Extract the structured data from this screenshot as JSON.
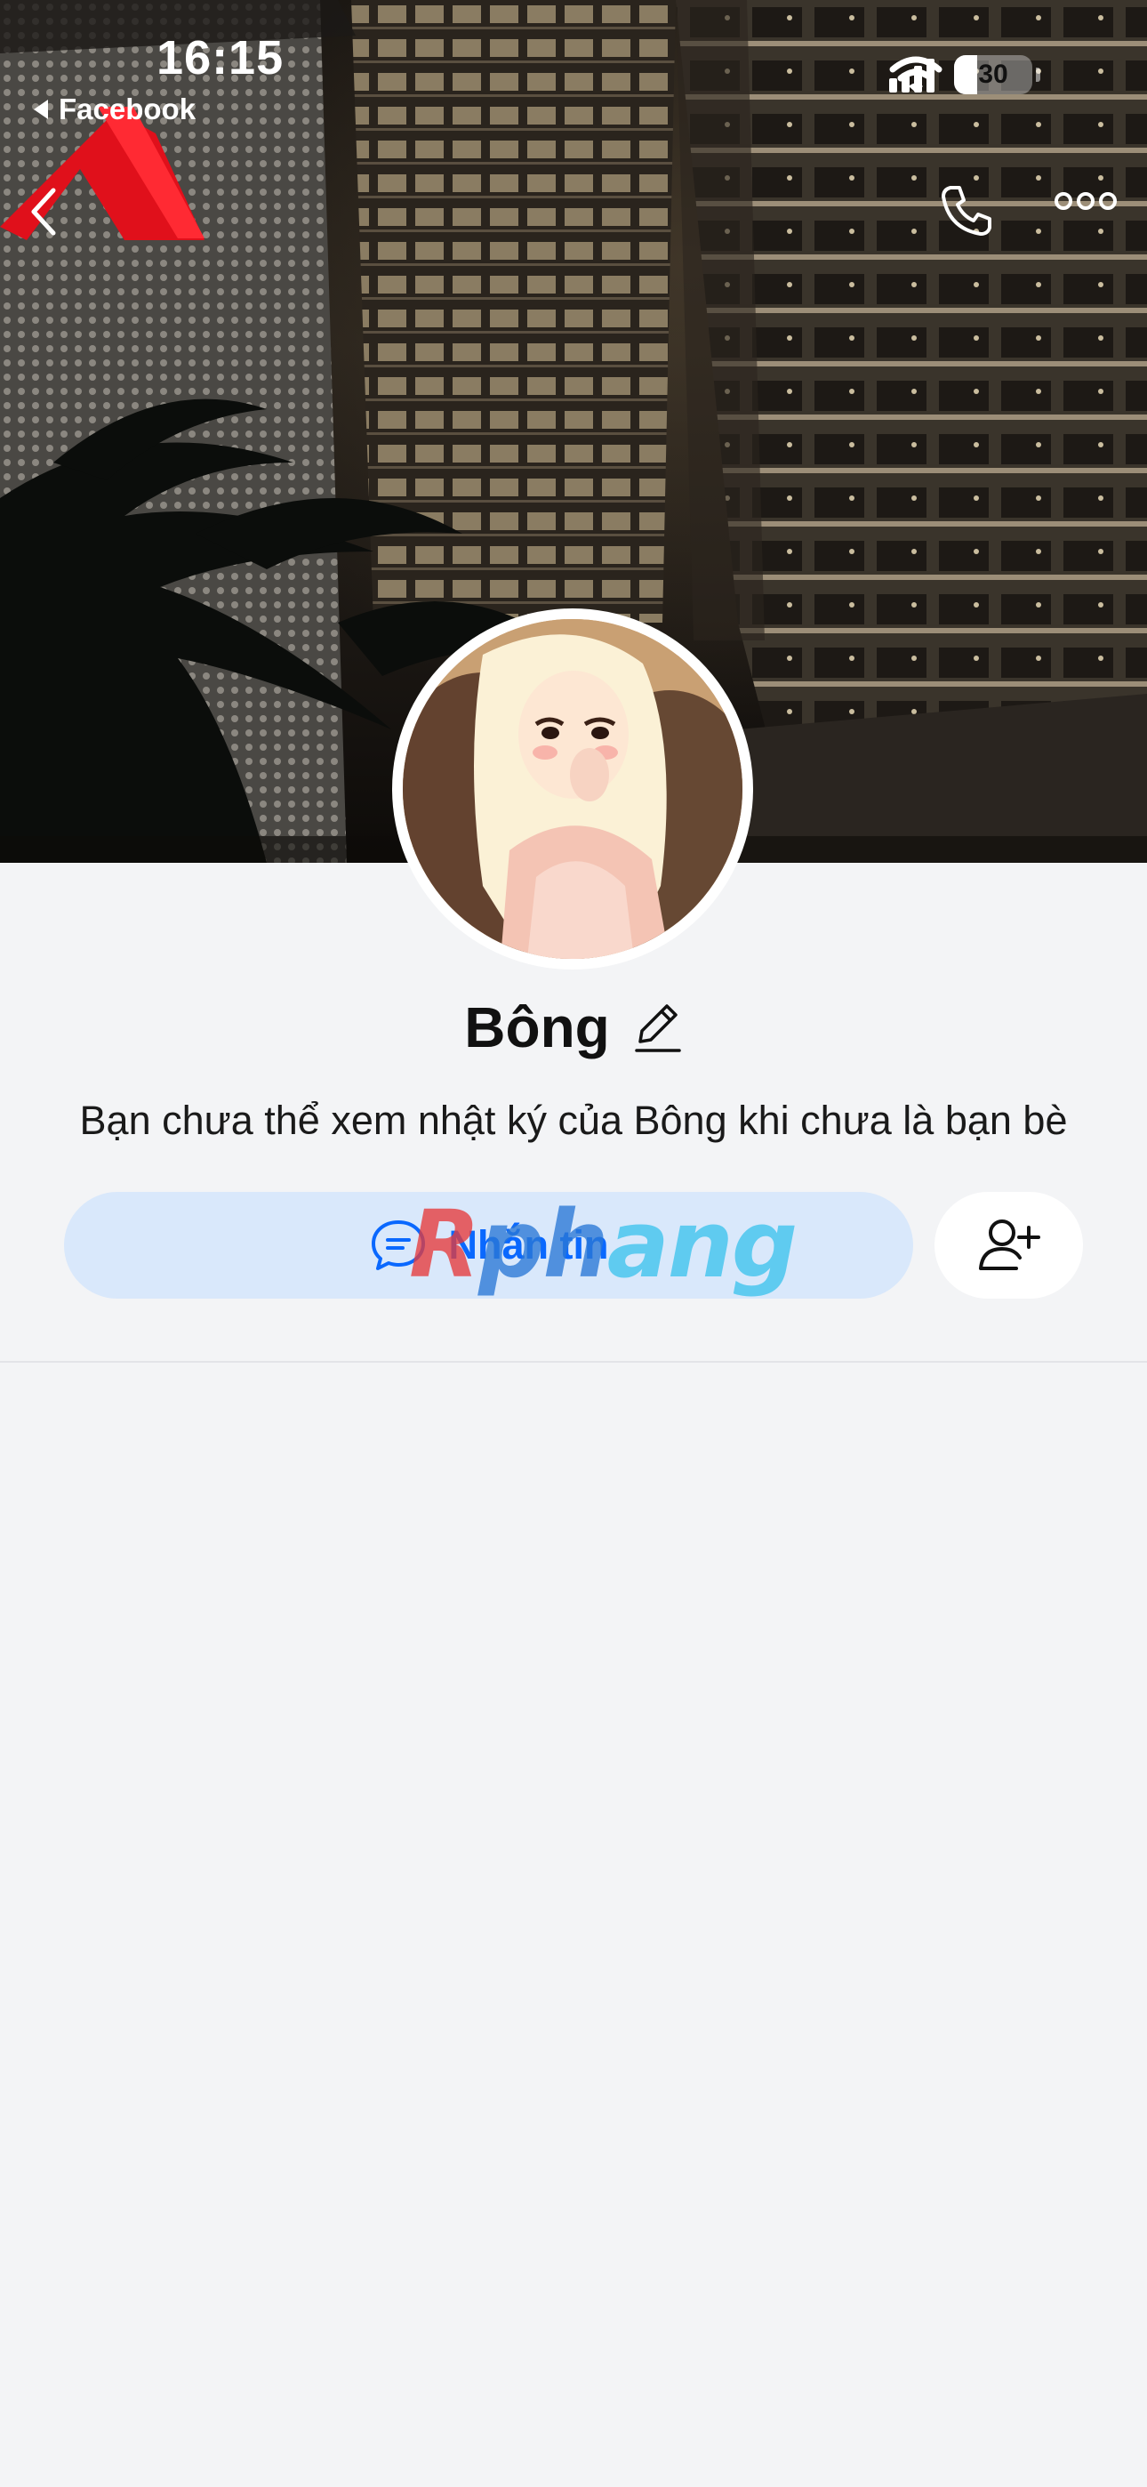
{
  "status_bar": {
    "time": "16:15",
    "back_app": "Facebook",
    "battery": "30",
    "battery_level": 0.3
  },
  "top_nav": {
    "back_icon": "chevron-left-icon",
    "call_icon": "phone-icon",
    "more_icon": "more-horizontal-icon"
  },
  "profile": {
    "name": "Bông",
    "edit_icon": "pencil-icon",
    "notice": "Bạn chưa thể xem nhật ký của Bông khi chưa là bạn bè"
  },
  "actions": {
    "message_label": "Nhắn tin",
    "message_icon": "chat-bubble-icon",
    "add_friend_icon": "add-user-icon"
  },
  "watermark": {
    "part_a": "R",
    "part_b": "ph",
    "part_c": "ang"
  },
  "colors": {
    "accent": "#0a68fe",
    "message_button_bg": "#d9e8fb",
    "page_bg": "#f3f4f6"
  }
}
